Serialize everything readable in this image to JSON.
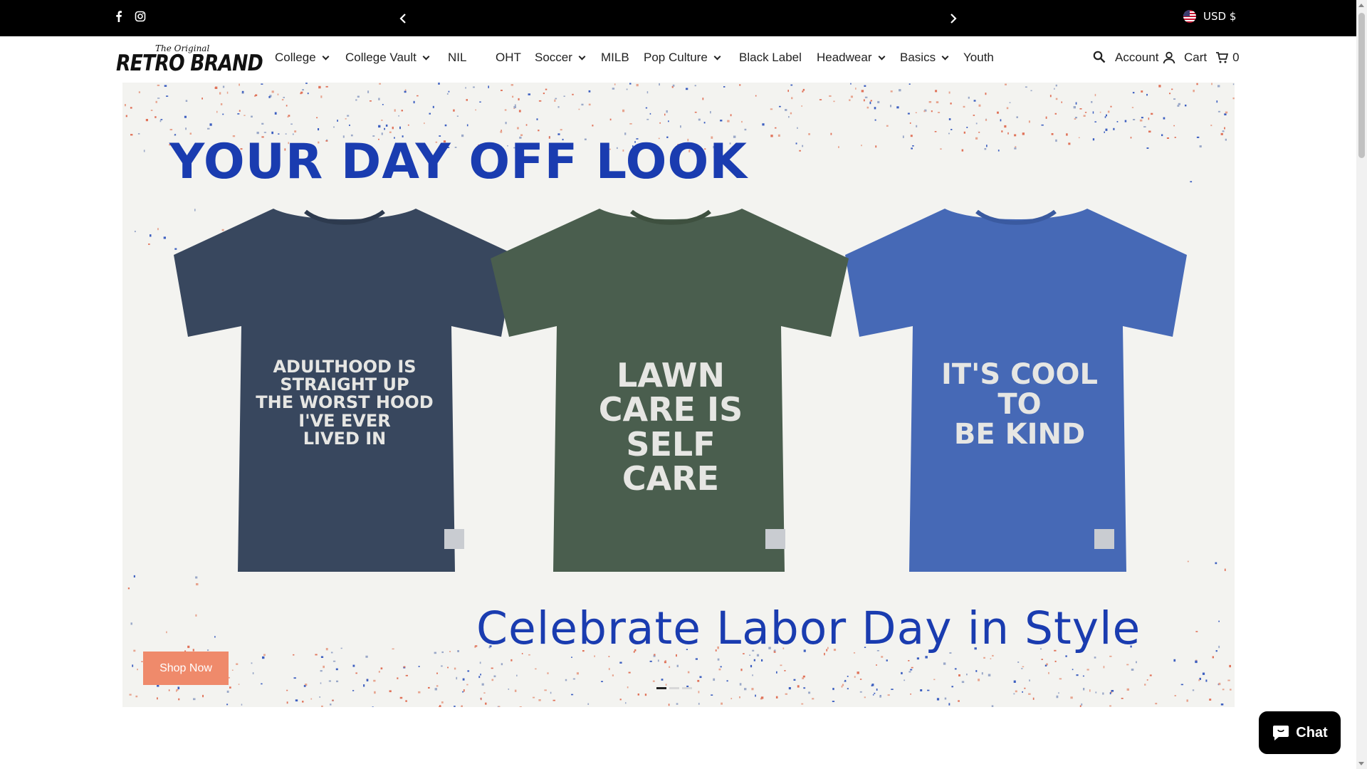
{
  "announcement": {
    "social_icons": [
      "facebook-icon",
      "instagram-icon"
    ],
    "prev_icon": "chevron-left-icon",
    "next_icon": "chevron-right-icon",
    "currency": "USD $",
    "currency_flag": "us-flag-icon"
  },
  "brand": {
    "logo_tagline": "The Original",
    "logo_name": "RETRO BRAND"
  },
  "nav": {
    "items": [
      {
        "label": "College",
        "dropdown": true
      },
      {
        "label": "College Vault",
        "dropdown": true
      },
      {
        "label": "NIL",
        "dropdown": false
      },
      {
        "label": "OHT",
        "dropdown": false
      },
      {
        "label": "Soccer",
        "dropdown": true
      },
      {
        "label": "MILB",
        "dropdown": false
      },
      {
        "label": "Pop Culture",
        "dropdown": true
      },
      {
        "label": "Black Label",
        "dropdown": false
      },
      {
        "label": "Headwear",
        "dropdown": true
      },
      {
        "label": "Basics",
        "dropdown": true
      },
      {
        "label": "Youth",
        "dropdown": false
      }
    ]
  },
  "header_right": {
    "search_icon": "search-icon",
    "account_label": "Account",
    "account_icon": "user-icon",
    "cart_label": "Cart",
    "cart_icon": "cart-icon",
    "cart_count": "0"
  },
  "hero": {
    "title": "YOUR DAY OFF LOOK",
    "subtitle": "Celebrate Labor Day in Style",
    "shirts": [
      {
        "color": "#38475e",
        "text_lines": [
          "ADULTHOOD IS",
          "STRAIGHT UP",
          "THE WORST HOOD",
          "I'VE EVER",
          "LIVED IN"
        ]
      },
      {
        "color": "#4a5e4e",
        "text_lines": [
          "LAWN",
          "CARE IS",
          "SELF",
          "CARE"
        ]
      },
      {
        "color": "#4669b6",
        "text_lines": [
          "IT'S COOL TO",
          "BE KIND"
        ]
      }
    ],
    "cta_label": "Shop Now",
    "cta_color": "#ef8a6b",
    "title_color": "#1a3cb0",
    "slide_count": 3,
    "active_slide": 1
  },
  "chat": {
    "label": "Chat",
    "icon": "chat-bubble-icon"
  }
}
